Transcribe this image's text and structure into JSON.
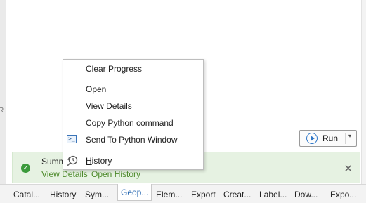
{
  "left_strip": {
    "mark": "R"
  },
  "run_button": {
    "label": "Run",
    "dropdown": "▾"
  },
  "status": {
    "summary": "Summary",
    "view_details": "View Details",
    "open_history": "Open History",
    "close": "✕",
    "icon": "check-circle-icon",
    "color": "#3b9a3b"
  },
  "context_menu": {
    "clear_progress": "Clear Progress",
    "open": "Open",
    "view_details": "View Details",
    "copy_python": "Copy Python command",
    "send_to_python": "Send To Python Window",
    "history_first": "H",
    "history_rest": "istory"
  },
  "tabs": [
    "Catal...",
    "History",
    "Sym...",
    "Geop...",
    "Elem...",
    "Export",
    "Creat...",
    "Label...",
    "Dow...",
    "Expo..."
  ],
  "active_tab": "Geop...",
  "accent": "#2b6bb3"
}
